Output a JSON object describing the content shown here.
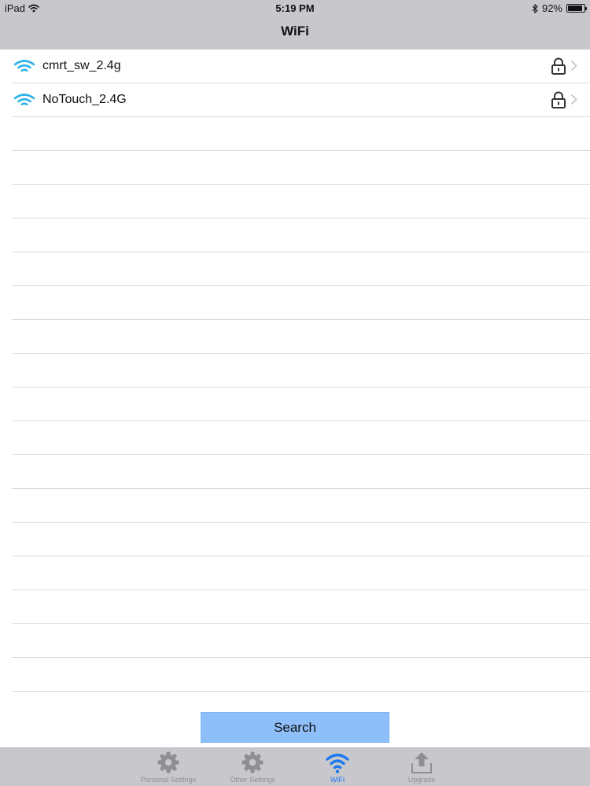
{
  "status_bar": {
    "device": "iPad",
    "time": "5:19 PM",
    "battery": "92%",
    "battery_level": 0.92,
    "icons": [
      "wifi-icon",
      "bluetooth-icon",
      "battery-icon"
    ]
  },
  "nav": {
    "title": "WiFi"
  },
  "networks": [
    {
      "ssid": "cmrt_sw_2.4g",
      "icon": "wifi-icon",
      "secured": true
    },
    {
      "ssid": "NoTouch_2.4G",
      "icon": "wifi-icon",
      "secured": true
    }
  ],
  "search_button": {
    "label": "Search"
  },
  "tabs": [
    {
      "label": "Personal Settings",
      "icon": "gear-icon",
      "active": false
    },
    {
      "label": "Other Settings",
      "icon": "gear-icon",
      "active": false
    },
    {
      "label": "WiFi",
      "icon": "wifi-icon",
      "active": true
    },
    {
      "label": "Upgrade",
      "icon": "upload-icon",
      "active": false
    }
  ],
  "colors": {
    "bar_background": "#c8c7cc",
    "accent": "#1a78f2",
    "wifi_signal": "#2bb2e8",
    "search_button": "#8ebffb",
    "tab_inactive": "#8e8e93"
  }
}
